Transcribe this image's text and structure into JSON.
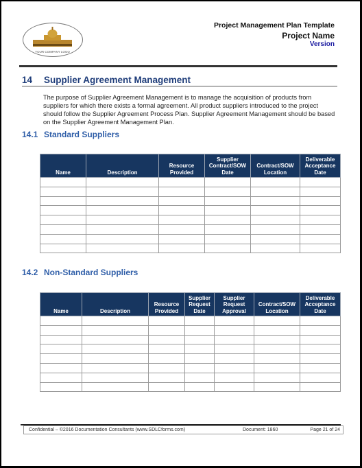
{
  "header": {
    "doc_title": "Project Management Plan Template",
    "project_name": "Project Name",
    "version": "Version",
    "logo_text": "YOUR COMPANY LOGO"
  },
  "section": {
    "number": "14",
    "title": "Supplier Agreement Management",
    "paragraph": "The purpose of Supplier Agreement Management is to manage the acquisition of products from suppliers for which there exists a formal agreement.  All product suppliers introduced to the project should follow the Supplier Agreement Process Plan. Supplier Agreement Management should be based on the Supplier Agreement Management Plan."
  },
  "standard": {
    "number": "14.1",
    "title": "Standard Suppliers",
    "columns": [
      "Name",
      "Description",
      "Resource Provided",
      "Supplier Contract/SOW Date",
      "Contract/SOW Location",
      "Deliverable Acceptance Date"
    ],
    "rows": 8
  },
  "nonstandard": {
    "number": "14.2",
    "title": "Non-Standard Suppliers",
    "columns": [
      "Name",
      "Description",
      "Resource Provided",
      "Supplier Request Date",
      "Supplier Request Approval",
      "Contract/SOW Location",
      "Deliverable Acceptance Date"
    ],
    "rows": 8
  },
  "footer": {
    "confidential": "Confidential – ©2016 Documentation Consultants (www.SDLCforms.com)",
    "document": "Document: 1860",
    "page": "Page 21 of 24"
  },
  "colors": {
    "heading": "#1f3d7a",
    "subheading": "#2f5ea8",
    "table_header": "#173660",
    "version": "#1a1aa0"
  }
}
